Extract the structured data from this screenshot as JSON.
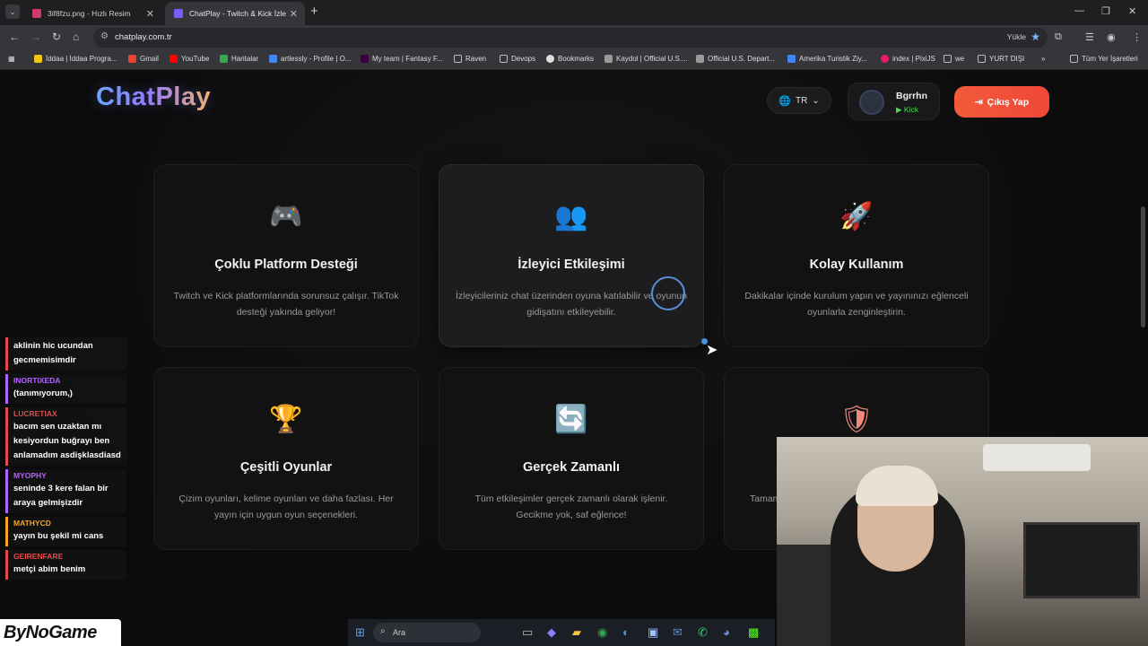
{
  "browser": {
    "tabs": [
      {
        "title": "3if8fzu.png - Hızlı Resim",
        "fav_color": "#d23a6a"
      },
      {
        "title": "ChatPlay - Twitch & Kick İzleyic",
        "fav_color": "#7b5cff"
      }
    ],
    "url": "chatplay.com.tr",
    "install_label": "Yükle",
    "bookmarks": [
      {
        "label": "İddaa | İddaa Progra...",
        "color": "#f5c518"
      },
      {
        "label": "Gmail",
        "color": "#ea4335"
      },
      {
        "label": "YouTube",
        "color": "#ff0000"
      },
      {
        "label": "Haritalar",
        "color": "#34a853"
      },
      {
        "label": "artlessly - Profile | O...",
        "color": "#4285f4"
      },
      {
        "label": "My team | Fantasy F...",
        "color": "#37003c"
      },
      {
        "label": "Raven",
        "color": "#888888"
      },
      {
        "label": "Devops",
        "color": "#888888"
      },
      {
        "label": "Bookmarks",
        "color": "#dddddd"
      },
      {
        "label": "Kaydol | Official U.S....",
        "color": "#999999"
      },
      {
        "label": "Official U.S. Depart...",
        "color": "#999999"
      },
      {
        "label": "Amerika Turistik Ziy...",
        "color": "#4285f4"
      },
      {
        "label": "index | PixiJS",
        "color": "#e91e63"
      },
      {
        "label": "we",
        "color": "#888888"
      },
      {
        "label": "YURT DIŞI",
        "color": "#888888"
      }
    ],
    "all_bookmarks": "Tüm Yer İşaretleri"
  },
  "header": {
    "logo": "ChatPlay",
    "lang": "TR",
    "user_name": "Bgrrhn",
    "user_platform": "Kick",
    "logout": "Çıkış Yap"
  },
  "features": [
    {
      "icon": "🎮",
      "title": "Çoklu Platform Desteği",
      "desc": "Twitch ve Kick platformlarında sorunsuz çalışır. TikTok desteği yakında geliyor!"
    },
    {
      "icon": "👥",
      "title": "İzleyici Etkileşimi",
      "desc": "İzleyicileriniz chat üzerinden oyuna katılabilir ve oyunun gidişatını etkileyebilir."
    },
    {
      "icon": "🚀",
      "title": "Kolay Kullanım",
      "desc": "Dakikalar içinde kurulum yapın ve yayınınızı eğlenceli oyunlarla zenginleştirin."
    },
    {
      "icon": "🏆",
      "title": "Çeşitli Oyunlar",
      "desc": "Çizim oyunları, kelime oyunları ve daha fazlası. Her yayın için uygun oyun seçenekleri."
    },
    {
      "icon": "🔄",
      "title": "Gerçek Zamanlı",
      "desc": "Tüm etkileşimler gerçek zamanlı olarak işlenir. Gecikme yok, saf eğlence!"
    },
    {
      "icon": "🛡",
      "title": "",
      "desc": "Tamam"
    }
  ],
  "chat": [
    {
      "user": "",
      "color": "#e34b4b",
      "text": "aklinin hic ucundan gecmemisimdir"
    },
    {
      "user": "INORTIXEDA",
      "color": "#b264ff",
      "text": "(tanımıyorum,)"
    },
    {
      "user": "LUCRETIAX",
      "color": "#e34b4b",
      "text": "bacım sen uzaktan mı kesiyordun buğrayı ben anlamadım asdişklasdiasd"
    },
    {
      "user": "MYOPHY",
      "color": "#b264ff",
      "text": "seninde 3 kere falan bir araya gelmişizdir"
    },
    {
      "user": "MATHYCD",
      "color": "#f5a623",
      "text": "yayın bu şekil mi cans"
    },
    {
      "user": "GEIRENFARE",
      "color": "#e34b4b",
      "text": "metçi abim benim"
    }
  ],
  "overlay": {
    "brand": "ByNoGame"
  },
  "taskbar": {
    "search": "Ara"
  }
}
